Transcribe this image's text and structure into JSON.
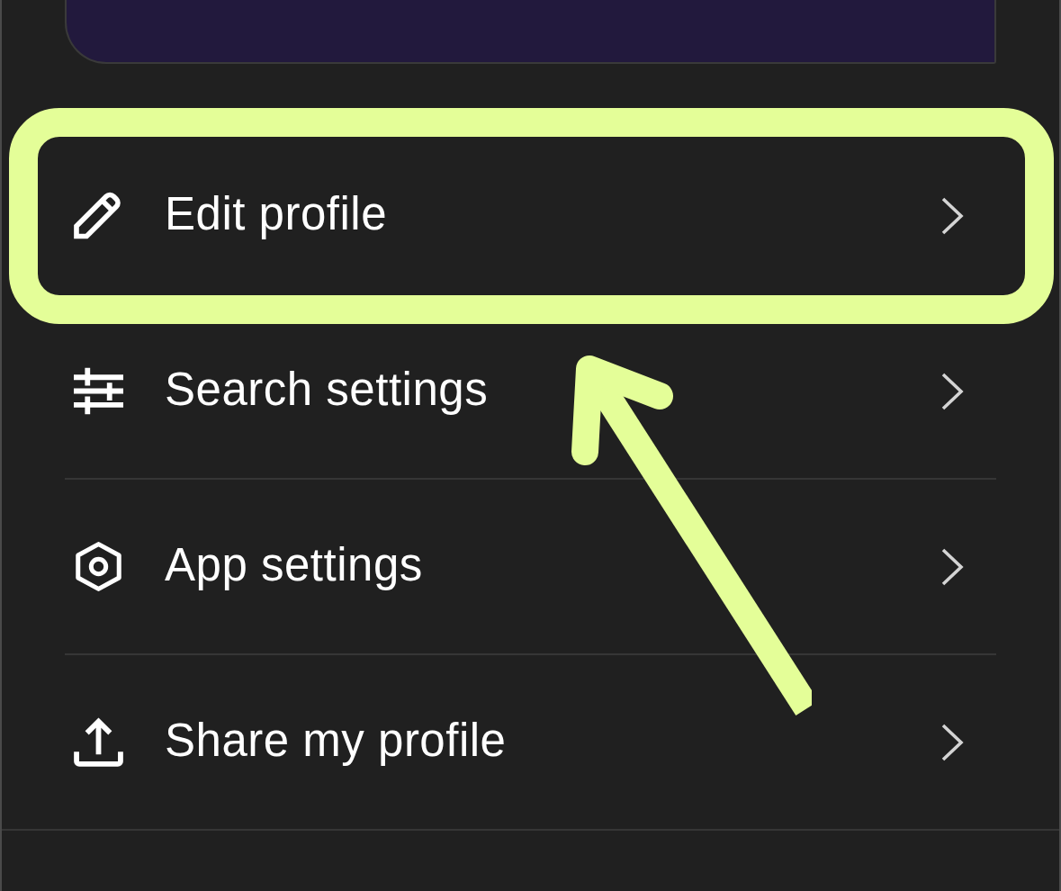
{
  "menu": {
    "items": [
      {
        "label": "Edit profile",
        "highlighted": true
      },
      {
        "label": "Search settings",
        "highlighted": false
      },
      {
        "label": "App settings",
        "highlighted": false
      },
      {
        "label": "Share my profile",
        "highlighted": false
      }
    ]
  }
}
